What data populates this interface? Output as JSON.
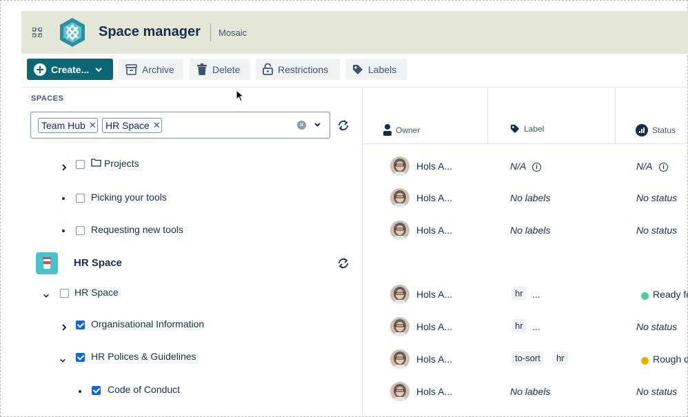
{
  "header": {
    "title": "Space manager",
    "subtitle": "Mosaic",
    "grid_icon": "app-switcher-icon",
    "logo": "mosaic-logo",
    "bg_color": "#e4e6d6"
  },
  "toolbar": {
    "create_label": "Create...",
    "archive_label": "Archive",
    "delete_label": "Delete",
    "restrictions_label": "Restrictions",
    "labels_label": "Labels",
    "create_color": "#0b6676"
  },
  "spaces": {
    "section_label": "SPACES",
    "selected_tags": [
      "Team Hub",
      "HR Space"
    ],
    "hr_space_title": "HR Space"
  },
  "tree": [
    {
      "label": "Projects",
      "has_folder": true,
      "expander": "collapsed",
      "checked": false
    },
    {
      "label": "Picking your tools",
      "expander": "bullet",
      "checked": false
    },
    {
      "label": "Requesting new tools",
      "expander": "bullet",
      "checked": false
    },
    {
      "label": "HR Space",
      "expander": "expanded",
      "checked": false
    },
    {
      "label": "Organisational Information",
      "expander": "collapsed",
      "checked": true
    },
    {
      "label": "HR Polices & Guidelines",
      "expander": "expanded",
      "checked": true
    },
    {
      "label": "Code of Conduct",
      "expander": "bullet",
      "checked": true
    }
  ],
  "columns": {
    "owner": "Owner",
    "label": "Label",
    "status": "Status"
  },
  "rows": [
    {
      "owner": "Hols A...",
      "label": "N/A",
      "status": "N/A"
    },
    {
      "owner": "Hols A...",
      "label": "No labels",
      "status": "No status"
    },
    {
      "owner": "Hols A...",
      "label": "No labels",
      "status": "No status"
    },
    {
      "owner": "Hols A...",
      "labels": [
        "hr",
        "..."
      ],
      "status": "Ready fo",
      "status_color": "#4bce97"
    },
    {
      "owner": "Hols A...",
      "labels": [
        "hr",
        "..."
      ],
      "status": "No status"
    },
    {
      "owner": "Hols A...",
      "labels": [
        "to-sort",
        "hr"
      ],
      "status": "Rough d",
      "status_color": "#e2b203"
    },
    {
      "owner": "Hols A...",
      "label": "No labels",
      "status": "No status"
    }
  ]
}
